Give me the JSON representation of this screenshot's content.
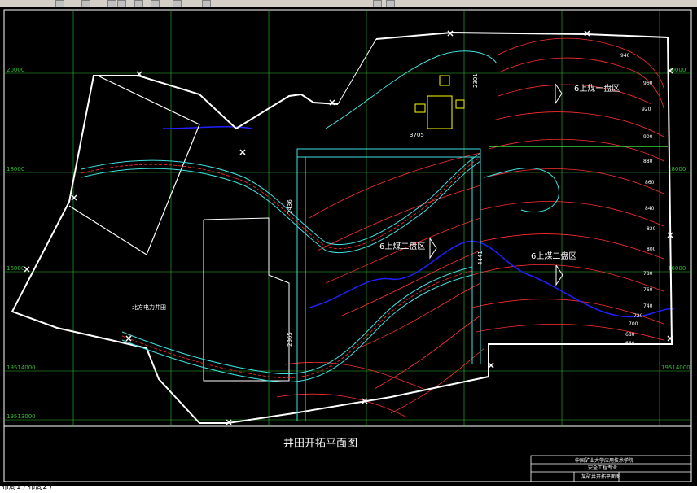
{
  "toolbar": {
    "icons": [
      "tool-icon-1",
      "tool-icon-2",
      "tool-icon-3",
      "tool-icon-4",
      "tool-icon-5",
      "tool-icon-6",
      "tool-icon-7",
      "tool-icon-8",
      "tool-icon-9",
      "tool-icon-10"
    ]
  },
  "colors": {
    "background": "#000000",
    "grid": "#2fbf2f",
    "boundary": "#ffffff",
    "contour": "#ff3030",
    "road": "#40e0e0",
    "river": "#2020ff",
    "accent": "#ffff00"
  },
  "drawing": {
    "title": "井田开拓平面图",
    "areas": {
      "first_panel": "6上煤一盘区",
      "second_panel_left": "6上煤二盘区",
      "second_panel_right": "6上煤二盘区"
    },
    "well_field": "北方电力井田",
    "dimensions": {
      "d1": "2301",
      "d2": "3705",
      "d3": "2436",
      "d4": "4441",
      "d5": "2865"
    },
    "coords": {
      "left_1": "20000",
      "left_2": "18000",
      "left_3": "16000",
      "left_4": "19514000",
      "left_5": "19513000",
      "right_1": "20000",
      "right_2": "18000",
      "right_3": "16000",
      "right_4": "19514000"
    },
    "contours": [
      "940",
      "960",
      "920",
      "900",
      "880",
      "860",
      "840",
      "820",
      "800",
      "780",
      "760",
      "740",
      "720",
      "700",
      "680",
      "660"
    ]
  },
  "title_block": {
    "school": "中国矿业大学应用技术学院",
    "major": "安全工程专业",
    "drawing_name": "某矿井开拓平面图"
  },
  "statusbar": {
    "text": "布局1 / 布局2 /"
  }
}
